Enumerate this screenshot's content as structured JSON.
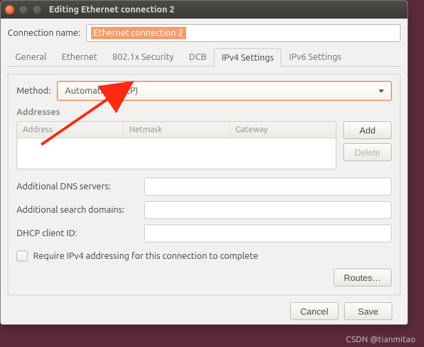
{
  "window": {
    "title": "Editing Ethernet connection 2"
  },
  "connection": {
    "label": "Connection name:",
    "value": "Ethernet connection 2"
  },
  "tabs": [
    {
      "label": "General"
    },
    {
      "label": "Ethernet"
    },
    {
      "label": "802.1x Security"
    },
    {
      "label": "DCB"
    },
    {
      "label": "IPv4 Settings"
    },
    {
      "label": "IPv6 Settings"
    }
  ],
  "active_tab_index": 4,
  "method": {
    "label": "Method:",
    "value": "Automatic (DHCP)"
  },
  "addresses": {
    "section_label": "Addresses",
    "columns": [
      "Address",
      "Netmask",
      "Gateway"
    ],
    "rows": [],
    "add_label": "Add",
    "delete_label": "Delete"
  },
  "fields": {
    "dns_label": "Additional DNS servers:",
    "dns_value": "",
    "search_label": "Additional search domains:",
    "search_value": "",
    "dhcp_id_label": "DHCP client ID:",
    "dhcp_id_value": ""
  },
  "require_ipv4": {
    "label": "Require IPv4 addressing for this connection to complete",
    "checked": false
  },
  "routes_label": "Routes…",
  "footer": {
    "cancel": "Cancel",
    "save": "Save"
  },
  "watermark": "CSDN @tianmitao",
  "annotation_color": "#ff2a12"
}
